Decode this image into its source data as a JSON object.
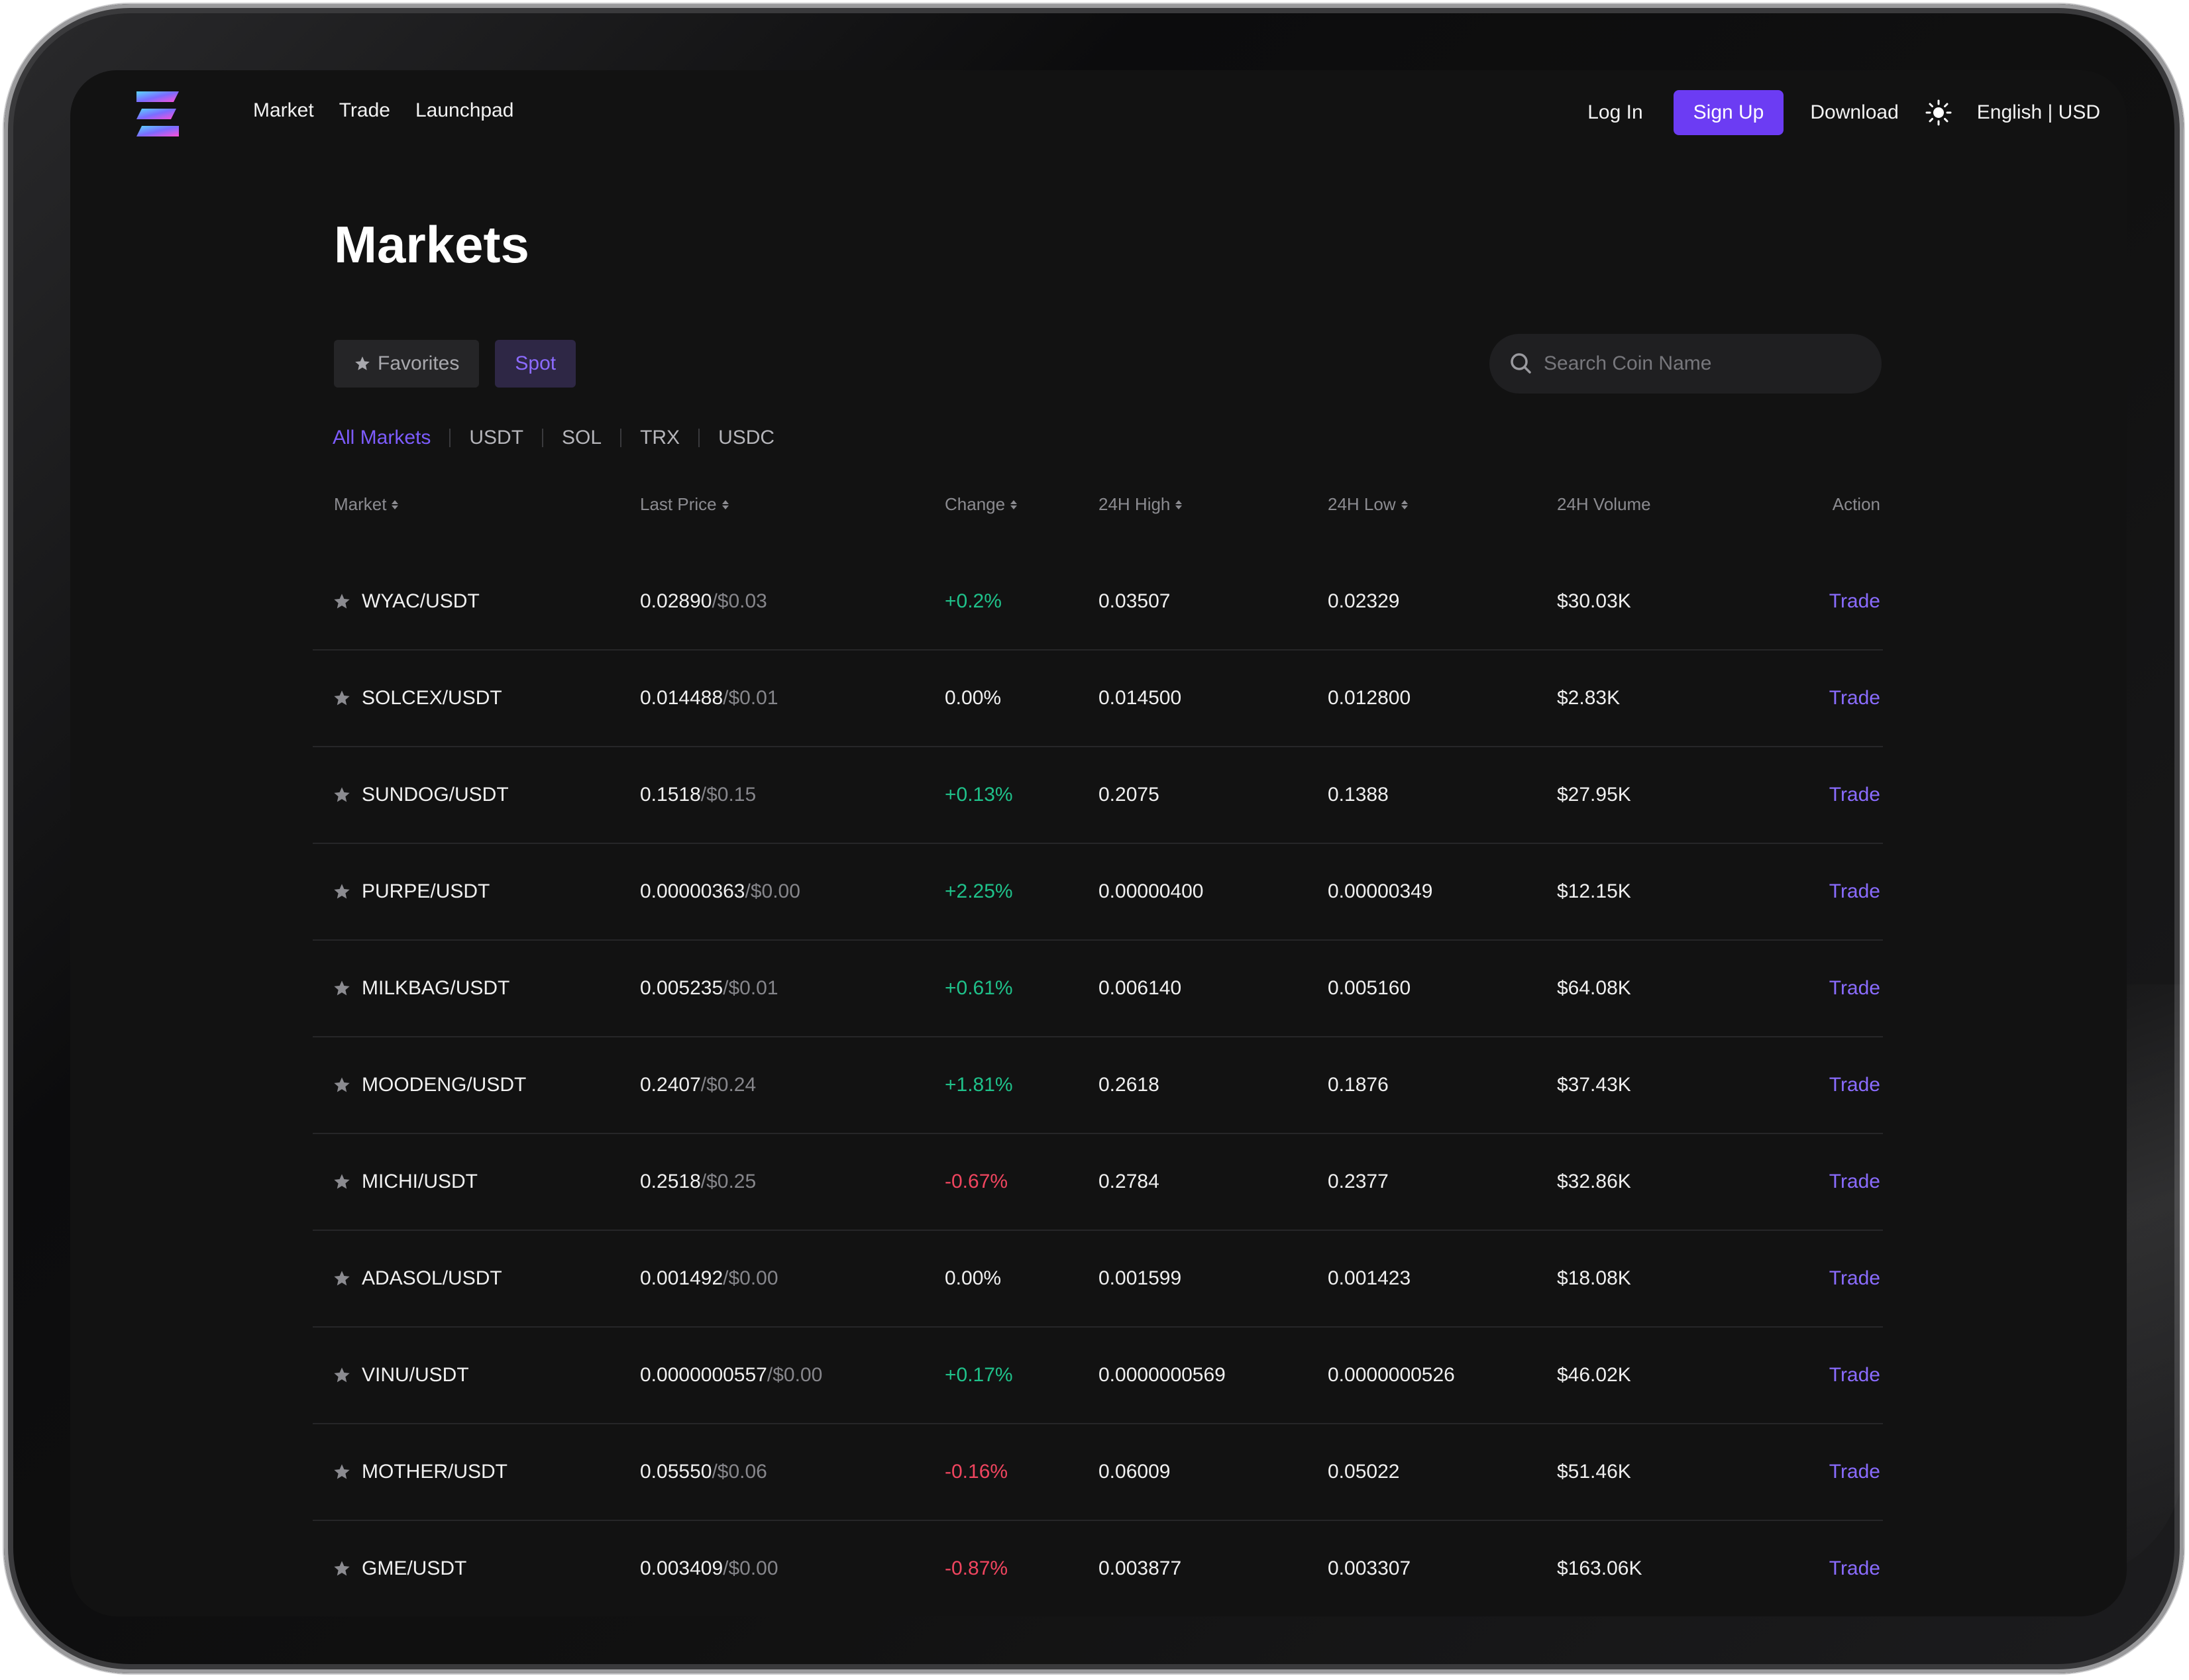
{
  "nav": {
    "links": [
      "Market",
      "Trade",
      "Launchpad"
    ],
    "login": "Log In",
    "signup": "Sign Up",
    "download": "Download",
    "language": "English | USD"
  },
  "page": {
    "title": "Markets",
    "tabs": {
      "favorites": "Favorites",
      "spot": "Spot"
    },
    "search_placeholder": "Search Coin Name",
    "filters": [
      "All Markets",
      "USDT",
      "SOL",
      "TRX",
      "USDC"
    ],
    "active_filter": "All Markets"
  },
  "table": {
    "headers": {
      "market": "Market",
      "last_price": "Last Price",
      "change": "Change",
      "high": "24H High",
      "low": "24H Low",
      "volume": "24H Volume",
      "action": "Action"
    },
    "rows": [
      {
        "pair": "WYAC/USDT",
        "price": "0.02890",
        "usd": "/$0.03",
        "change": "+0.2%",
        "trend": "pos",
        "high": "0.03507",
        "low": "0.02329",
        "volume": "$30.03K",
        "action": "Trade"
      },
      {
        "pair": "SOLCEX/USDT",
        "price": "0.014488",
        "usd": "/$0.01",
        "change": "0.00%",
        "trend": "zero",
        "high": "0.014500",
        "low": "0.012800",
        "volume": "$2.83K",
        "action": "Trade"
      },
      {
        "pair": "SUNDOG/USDT",
        "price": "0.1518",
        "usd": "/$0.15",
        "change": "+0.13%",
        "trend": "pos",
        "high": "0.2075",
        "low": "0.1388",
        "volume": "$27.95K",
        "action": "Trade"
      },
      {
        "pair": "PURPE/USDT",
        "price": "0.00000363",
        "usd": "/$0.00",
        "change": "+2.25%",
        "trend": "pos",
        "high": "0.00000400",
        "low": "0.00000349",
        "volume": "$12.15K",
        "action": "Trade"
      },
      {
        "pair": "MILKBAG/USDT",
        "price": "0.005235",
        "usd": "/$0.01",
        "change": "+0.61%",
        "trend": "pos",
        "high": "0.006140",
        "low": "0.005160",
        "volume": "$64.08K",
        "action": "Trade"
      },
      {
        "pair": "MOODENG/USDT",
        "price": "0.2407",
        "usd": "/$0.24",
        "change": "+1.81%",
        "trend": "pos",
        "high": "0.2618",
        "low": "0.1876",
        "volume": "$37.43K",
        "action": "Trade"
      },
      {
        "pair": "MICHI/USDT",
        "price": "0.2518",
        "usd": "/$0.25",
        "change": "-0.67%",
        "trend": "neg",
        "high": "0.2784",
        "low": "0.2377",
        "volume": "$32.86K",
        "action": "Trade"
      },
      {
        "pair": "ADASOL/USDT",
        "price": "0.001492",
        "usd": "/$0.00",
        "change": "0.00%",
        "trend": "zero",
        "high": "0.001599",
        "low": "0.001423",
        "volume": "$18.08K",
        "action": "Trade"
      },
      {
        "pair": "VINU/USDT",
        "price": "0.0000000557",
        "usd": "/$0.00",
        "change": "+0.17%",
        "trend": "pos",
        "high": "0.0000000569",
        "low": "0.0000000526",
        "volume": "$46.02K",
        "action": "Trade"
      },
      {
        "pair": "MOTHER/USDT",
        "price": "0.05550",
        "usd": "/$0.06",
        "change": "-0.16%",
        "trend": "neg",
        "high": "0.06009",
        "low": "0.05022",
        "volume": "$51.46K",
        "action": "Trade"
      },
      {
        "pair": "GME/USDT",
        "price": "0.003409",
        "usd": "/$0.00",
        "change": "-0.87%",
        "trend": "neg",
        "high": "0.003877",
        "low": "0.003307",
        "volume": "$163.06K",
        "action": "Trade"
      }
    ]
  },
  "colors": {
    "accent": "#6c3cf3",
    "positive": "#1fc18a",
    "negative": "#f0455f",
    "link": "#8a6cff"
  },
  "icons": {
    "logo": "exchange-logo",
    "theme": "sun-icon",
    "search": "search-icon",
    "favorite": "star-icon",
    "sort": "sort-icon"
  }
}
